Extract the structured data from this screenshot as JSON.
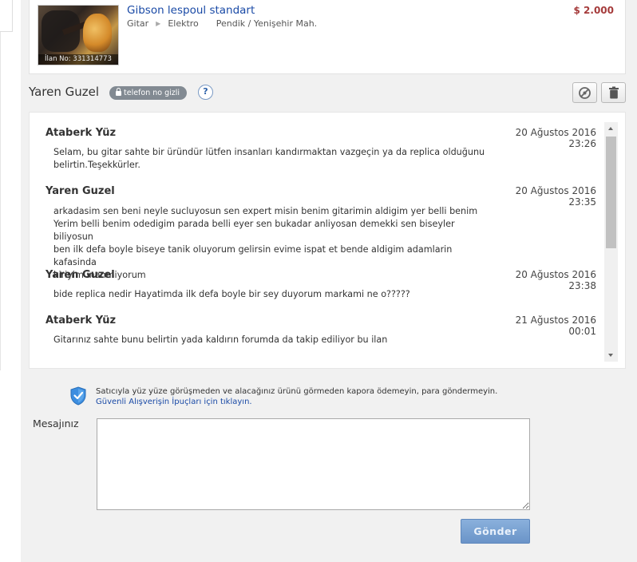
{
  "listing": {
    "title": "Gibson lespoul standart",
    "category": "Gitar",
    "subcategory": "Elektro",
    "location": "Pendik / Yenişehir Mah.",
    "price": "$ 2.000",
    "ad_number": "İlan No: 331314773"
  },
  "conversation": {
    "user_name": "Yaren Guzel",
    "phone_badge": "telefon no gizli",
    "help_label": "?"
  },
  "messages": [
    {
      "author": "Ataberk Yüz",
      "date": "20 Ağustos 2016",
      "time": "23:26",
      "lines": [
        "Selam, bu gitar sahte bir üründür lütfen insanları kandırmaktan vazgeçin ya da replica olduğunu",
        "belirtin.Teşekkürler."
      ]
    },
    {
      "author": "Yaren Guzel",
      "date": "20 Ağustos 2016",
      "time": "23:35",
      "lines": [
        "arkadasim sen beni neyle sucluyosun sen expert misin benim gitarimin aldigim yer belli benim",
        "Yerim belli benim odedigim parada belli eyer sen bukadar anliyosan demekki sen biseyler biliyosun",
        "ben ilk defa boyle biseye tanik oluyorum gelirsin evime ispat et bende aldigim adamlarin kafasinda",
        "kiriyim inanmiyorum"
      ]
    },
    {
      "author": "Yaren Guzel",
      "date": "20 Ağustos 2016",
      "time": "23:38",
      "lines": [
        "bide replica nedir Hayatimda ilk defa boyle bir sey duyorum markami ne o?????"
      ]
    },
    {
      "author": "Ataberk Yüz",
      "date": "21 Ağustos 2016",
      "time": "00:01",
      "lines": [
        "Gitarınız sahte bunu belirtin yada kaldırın forumda da takip ediliyor bu ilan"
      ]
    }
  ],
  "safety": {
    "warning": "Satıcıyla yüz yüze görüşmeden ve alacağınız ürünü görmeden kapora ödemeyin, para göndermeyin.",
    "link": "Güvenli Alışverişin İpuçları için tıklayın."
  },
  "compose": {
    "label": "Mesajınız",
    "value": "",
    "send_label": "Gönder"
  },
  "colors": {
    "link": "#1a4aa6",
    "price": "#a53b3b",
    "send_button": "#7aa2d4",
    "badge": "#828a92"
  }
}
